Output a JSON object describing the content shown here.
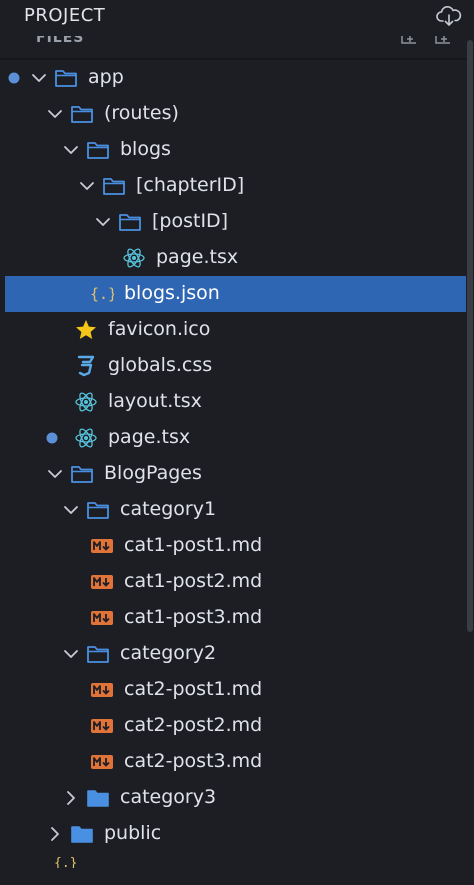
{
  "header": {
    "title": "PROJECT",
    "section_label": "FILES"
  },
  "tree": [
    {
      "label": "app",
      "type": "folder",
      "expanded": true,
      "depth": 0,
      "modified_dot": true
    },
    {
      "label": "(routes)",
      "type": "folder",
      "expanded": true,
      "depth": 1
    },
    {
      "label": "blogs",
      "type": "folder",
      "expanded": true,
      "depth": 2
    },
    {
      "label": "[chapterID]",
      "type": "folder",
      "expanded": true,
      "depth": 3
    },
    {
      "label": "[postID]",
      "type": "folder",
      "expanded": true,
      "depth": 4
    },
    {
      "label": "page.tsx",
      "type": "react",
      "depth": 5
    },
    {
      "label": "blogs.json",
      "type": "json",
      "depth": 3,
      "selected": true
    },
    {
      "label": "favicon.ico",
      "type": "star",
      "depth": 2
    },
    {
      "label": "globals.css",
      "type": "css",
      "depth": 2
    },
    {
      "label": "layout.tsx",
      "type": "react",
      "depth": 2
    },
    {
      "label": "page.tsx",
      "type": "react",
      "depth": 2,
      "modified_dot": true
    },
    {
      "label": "BlogPages",
      "type": "folder",
      "expanded": true,
      "depth": 1
    },
    {
      "label": "category1",
      "type": "folder",
      "expanded": true,
      "depth": 2
    },
    {
      "label": "cat1-post1.md",
      "type": "markdown",
      "depth": 3
    },
    {
      "label": "cat1-post2.md",
      "type": "markdown",
      "depth": 3
    },
    {
      "label": "cat1-post3.md",
      "type": "markdown",
      "depth": 3
    },
    {
      "label": "category2",
      "type": "folder",
      "expanded": true,
      "depth": 2
    },
    {
      "label": "cat2-post1.md",
      "type": "markdown",
      "depth": 3
    },
    {
      "label": "cat2-post2.md",
      "type": "markdown",
      "depth": 3
    },
    {
      "label": "cat2-post3.md",
      "type": "markdown",
      "depth": 3
    },
    {
      "label": "category3",
      "type": "folder",
      "expanded": false,
      "depth": 2
    },
    {
      "label": "public",
      "type": "folder",
      "expanded": false,
      "depth": 1
    }
  ],
  "colors": {
    "folder": "#4a90e2",
    "react": "#58c4dc",
    "json": "#e0c36a",
    "css": "#5aa9e6",
    "markdown": "#e0733a",
    "star": "#f5c518",
    "dot": "#5b8fd6",
    "selection": "#2f66b3"
  },
  "icons": {
    "cloud": "cloud-download-icon",
    "chevron_open": "chevron-down-icon",
    "chevron_closed": "chevron-right-icon",
    "folder": "folder-icon",
    "react": "react-icon",
    "json": "json-braces-icon",
    "css": "css3-icon",
    "markdown": "markdown-icon",
    "star": "star-icon"
  }
}
